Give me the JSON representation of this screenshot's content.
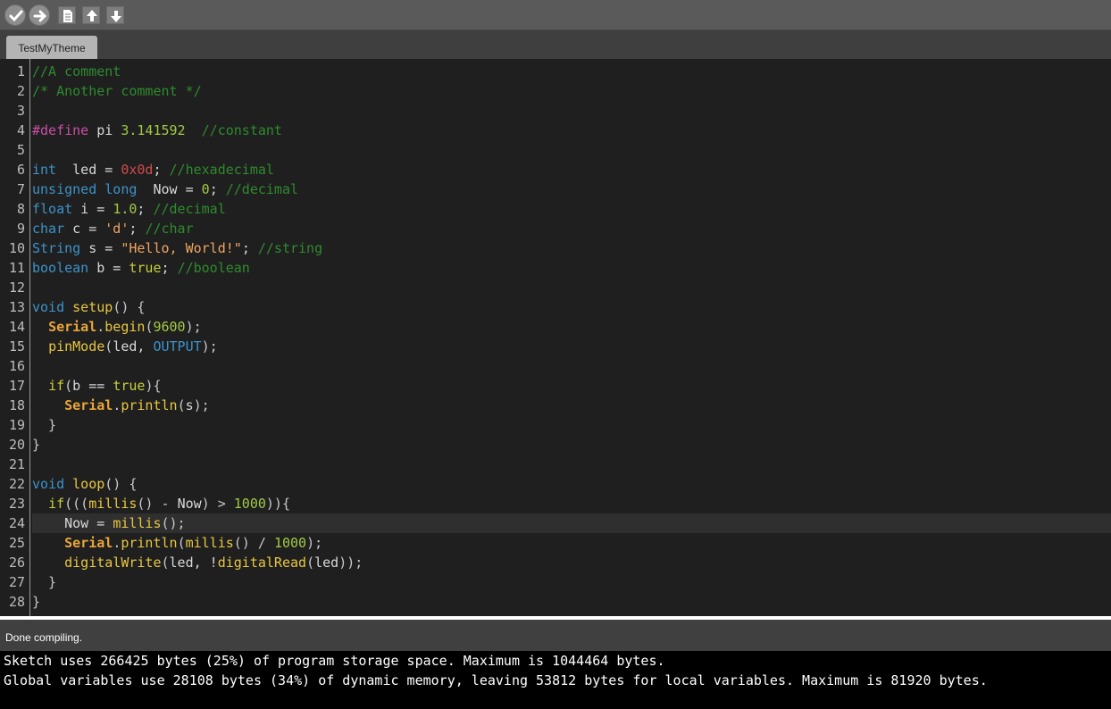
{
  "toolbar": {
    "buttons": [
      {
        "name": "verify-button",
        "icon": "checkmark-icon"
      },
      {
        "name": "upload-button",
        "icon": "right-arrow-icon"
      },
      {
        "name": "new-button",
        "icon": "document-icon"
      },
      {
        "name": "open-button",
        "icon": "up-arrow-icon"
      },
      {
        "name": "save-button",
        "icon": "down-arrow-icon"
      }
    ]
  },
  "tab": {
    "label": "TestMyTheme"
  },
  "editor": {
    "current_line": 24,
    "lines": [
      [
        [
          "comment",
          "//A comment"
        ]
      ],
      [
        [
          "comment",
          "/* Another comment */"
        ]
      ],
      [],
      [
        [
          "pre",
          "#define"
        ],
        [
          "id",
          " pi "
        ],
        [
          "num",
          "3.141592"
        ],
        [
          "id",
          "  "
        ],
        [
          "comment",
          "//constant"
        ]
      ],
      [],
      [
        [
          "type",
          "int"
        ],
        [
          "id",
          "  led = "
        ],
        [
          "hex",
          "0x0d"
        ],
        [
          "id",
          "; "
        ],
        [
          "comment",
          "//hexadecimal"
        ]
      ],
      [
        [
          "type",
          "unsigned long"
        ],
        [
          "id",
          "  Now = "
        ],
        [
          "num",
          "0"
        ],
        [
          "id",
          "; "
        ],
        [
          "comment",
          "//decimal"
        ]
      ],
      [
        [
          "type",
          "float"
        ],
        [
          "id",
          " i = "
        ],
        [
          "num",
          "1.0"
        ],
        [
          "id",
          "; "
        ],
        [
          "comment",
          "//decimal"
        ]
      ],
      [
        [
          "type",
          "char"
        ],
        [
          "id",
          " c = "
        ],
        [
          "str",
          "'d'"
        ],
        [
          "id",
          "; "
        ],
        [
          "comment",
          "//char"
        ]
      ],
      [
        [
          "type",
          "String"
        ],
        [
          "id",
          " s = "
        ],
        [
          "str",
          "\"Hello, World!\""
        ],
        [
          "id",
          "; "
        ],
        [
          "comment",
          "//string"
        ]
      ],
      [
        [
          "type",
          "boolean"
        ],
        [
          "id",
          " b = "
        ],
        [
          "kw",
          "true"
        ],
        [
          "id",
          "; "
        ],
        [
          "comment",
          "//boolean"
        ]
      ],
      [],
      [
        [
          "type",
          "void"
        ],
        [
          "id",
          " "
        ],
        [
          "fn",
          "setup"
        ],
        [
          "op",
          "() {"
        ]
      ],
      [
        [
          "id",
          "  "
        ],
        [
          "obj",
          "Serial"
        ],
        [
          "op",
          "."
        ],
        [
          "fn",
          "begin"
        ],
        [
          "op",
          "("
        ],
        [
          "num",
          "9600"
        ],
        [
          "op",
          ");"
        ]
      ],
      [
        [
          "id",
          "  "
        ],
        [
          "fn",
          "pinMode"
        ],
        [
          "op",
          "("
        ],
        [
          "id",
          "led, "
        ],
        [
          "const",
          "OUTPUT"
        ],
        [
          "op",
          ");"
        ]
      ],
      [],
      [
        [
          "id",
          "  "
        ],
        [
          "kw",
          "if"
        ],
        [
          "op",
          "("
        ],
        [
          "id",
          "b == "
        ],
        [
          "kw",
          "true"
        ],
        [
          "op",
          "){"
        ]
      ],
      [
        [
          "id",
          "    "
        ],
        [
          "obj",
          "Serial"
        ],
        [
          "op",
          "."
        ],
        [
          "fn",
          "println"
        ],
        [
          "op",
          "("
        ],
        [
          "id",
          "s"
        ],
        [
          "op",
          ");"
        ]
      ],
      [
        [
          "op",
          "  }"
        ]
      ],
      [
        [
          "op",
          "}"
        ]
      ],
      [],
      [
        [
          "type",
          "void"
        ],
        [
          "id",
          " "
        ],
        [
          "fn",
          "loop"
        ],
        [
          "op",
          "() {"
        ]
      ],
      [
        [
          "id",
          "  "
        ],
        [
          "kw",
          "if"
        ],
        [
          "op",
          "((("
        ],
        [
          "fn",
          "millis"
        ],
        [
          "op",
          "() - "
        ],
        [
          "id",
          "Now"
        ],
        [
          "op",
          ") > "
        ],
        [
          "num",
          "1000"
        ],
        [
          "op",
          ")){"
        ]
      ],
      [
        [
          "id",
          "    Now = "
        ],
        [
          "fn",
          "millis"
        ],
        [
          "op",
          "();"
        ]
      ],
      [
        [
          "id",
          "    "
        ],
        [
          "obj",
          "Serial"
        ],
        [
          "op",
          "."
        ],
        [
          "fn",
          "println"
        ],
        [
          "op",
          "("
        ],
        [
          "fn",
          "millis"
        ],
        [
          "op",
          "() / "
        ],
        [
          "num",
          "1000"
        ],
        [
          "op",
          ");"
        ]
      ],
      [
        [
          "id",
          "    "
        ],
        [
          "fn",
          "digitalWrite"
        ],
        [
          "op",
          "("
        ],
        [
          "id",
          "led, !"
        ],
        [
          "fn",
          "digitalRead"
        ],
        [
          "op",
          "("
        ],
        [
          "id",
          "led"
        ],
        [
          "op",
          "));"
        ]
      ],
      [
        [
          "op",
          "  }"
        ]
      ],
      [
        [
          "op",
          "}"
        ]
      ]
    ]
  },
  "status": {
    "message": "Done compiling."
  },
  "console": {
    "lines": [
      "Sketch uses 266425 bytes (25%) of program storage space. Maximum is 1044464 bytes.",
      "Global variables use 28108 bytes (34%) of dynamic memory, leaving 53812 bytes for local variables. Maximum is 81920 bytes."
    ]
  }
}
